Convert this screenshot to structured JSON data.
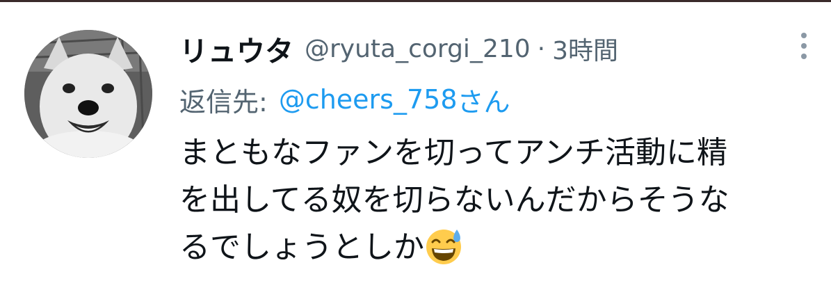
{
  "tweet": {
    "display_name": "リュウタ",
    "handle": "@ryuta_corgi_210",
    "separator": "·",
    "timestamp": "3時間",
    "reply_prefix": "返信先:",
    "reply_to_handle": "@cheers_758",
    "reply_suffix": "さん",
    "text_lines": [
      "まともなファンを切ってアンチ活動に精",
      "を出してる奴を切らないんだからそうな",
      "るでしょうとしか"
    ],
    "trailing_emoji": "grinning-face-with-sweat-icon"
  },
  "colors": {
    "text_primary": "#0f1419",
    "text_secondary": "#536471",
    "link_blue": "#1d9bf0",
    "more_dots": "#8b98a5"
  },
  "icons": {
    "avatar": "dog-photo-avatar",
    "more": "more-options-icon"
  }
}
